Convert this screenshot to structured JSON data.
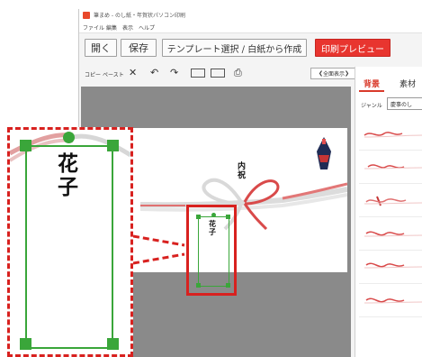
{
  "app": {
    "title": "筆まめ - のし紙・年賀状パソコン印刷",
    "menu": [
      "ファイル",
      "編集",
      "表示",
      "ヘルプ"
    ]
  },
  "main_buttons": {
    "open": "開く",
    "save": "保存",
    "template": "テンプレート選択 / 白紙から作成",
    "print_preview": "印刷プレビュー"
  },
  "toolbar": {
    "copy": "コピー",
    "paste": "ペースト",
    "full_view": "全面表示"
  },
  "panel": {
    "tab_background": "背景",
    "tab_material": "素材",
    "genre_label": "ジャンル",
    "genre_value": "慶事のし"
  },
  "noshi": {
    "omotegaki": "内祝",
    "name": "花子"
  },
  "colors": {
    "accent_red": "#e8352f",
    "selection_green": "#3aa63a",
    "callout_red": "#d8211f",
    "mizuhiki_red": "#d94a4a"
  }
}
